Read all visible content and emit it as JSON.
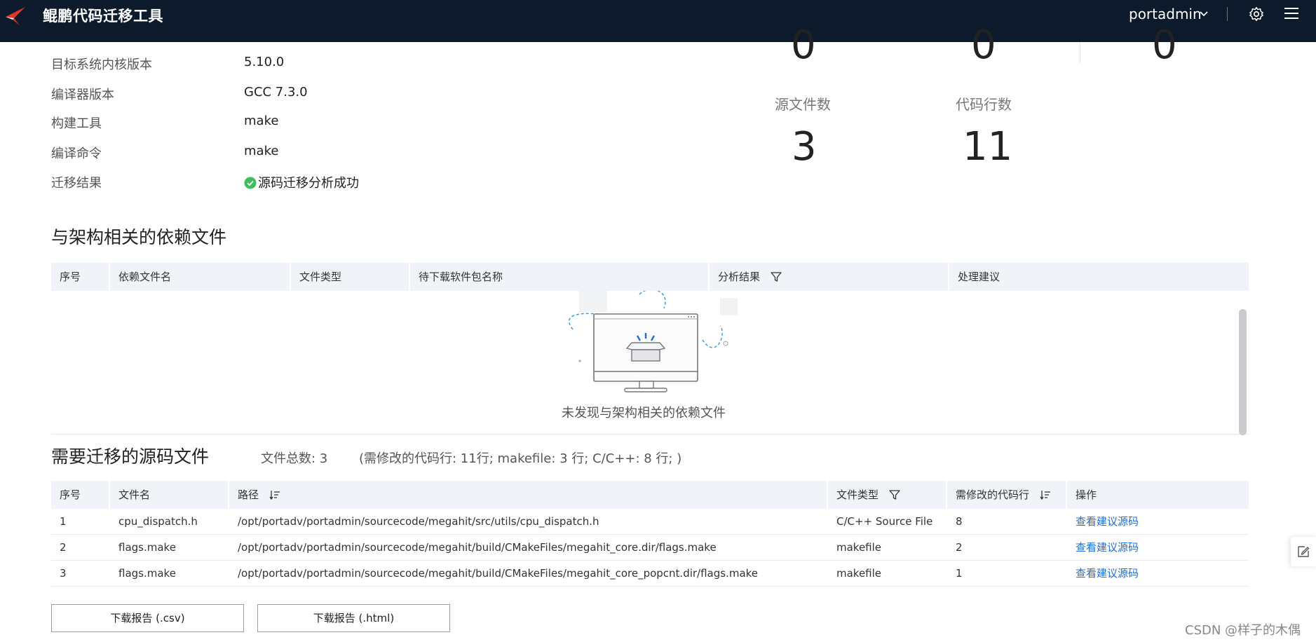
{
  "header": {
    "app_title": "鲲鹏代码迁移工具",
    "user": "portadmin",
    "bg_color": "#0d1a2b"
  },
  "info": [
    {
      "label": "目标系统内核版本",
      "value": "5.10.0"
    },
    {
      "label": "编译器版本",
      "value": "GCC 7.3.0"
    },
    {
      "label": "构建工具",
      "value": "make"
    },
    {
      "label": "编译命令",
      "value": "make"
    },
    {
      "label": "迁移结果",
      "value": "源码迁移分析成功"
    }
  ],
  "stats": {
    "top_values": [
      "0",
      "0",
      "0"
    ],
    "items": [
      {
        "label": "源文件数",
        "value": "3"
      },
      {
        "label": "代码行数",
        "value": "11"
      }
    ]
  },
  "dependency_section": {
    "title": "与架构相关的依赖文件",
    "columns": [
      "序号",
      "依赖文件名",
      "文件类型",
      "待下载软件包名称",
      "分析结果",
      "处理建议"
    ],
    "empty_text": "未发现与架构相关的依赖文件"
  },
  "source_section": {
    "title": "需要迁移的源码文件",
    "total_label": "文件总数: 3",
    "detail_label": "(需修改的代码行: 11行; makefile: 3 行; C/C++: 8 行; )",
    "columns": [
      "序号",
      "文件名",
      "路径",
      "文件类型",
      "需修改的代码行",
      "操作"
    ],
    "rows": [
      {
        "no": "1",
        "name": "cpu_dispatch.h",
        "path": "/opt/portadv/portadmin/sourcecode/megahit/src/utils/cpu_dispatch.h",
        "type": "C/C++ Source File",
        "lines": "8",
        "action": "查看建议源码"
      },
      {
        "no": "2",
        "name": "flags.make",
        "path": "/opt/portadv/portadmin/sourcecode/megahit/build/CMakeFiles/megahit_core.dir/flags.make",
        "type": "makefile",
        "lines": "2",
        "action": "查看建议源码"
      },
      {
        "no": "3",
        "name": "flags.make",
        "path": "/opt/portadv/portadmin/sourcecode/megahit/build/CMakeFiles/megahit_core_popcnt.dir/flags.make",
        "type": "makefile",
        "lines": "1",
        "action": "查看建议源码"
      }
    ]
  },
  "buttons": {
    "download_csv": "下载报告 (.csv)",
    "download_html": "下载报告 (.html)"
  },
  "watermark": "CSDN @样子的木偶",
  "colors": {
    "link": "#1e6fd9",
    "success": "#3cbf5c",
    "table_header_bg": "#f0f3f8"
  }
}
